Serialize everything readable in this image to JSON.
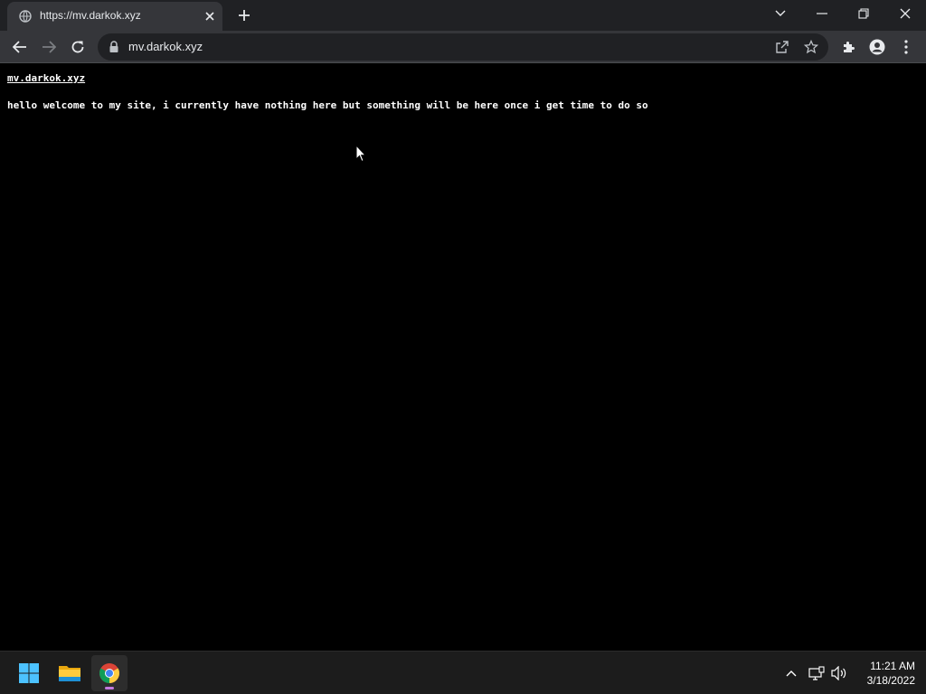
{
  "browser": {
    "tab": {
      "title": "https://mv.darkok.xyz",
      "favicon": "globe-icon"
    },
    "address_bar": {
      "url": "mv.darkok.xyz",
      "security_icon": "lock-icon"
    },
    "toolbar_icons": [
      "back-arrow-icon",
      "forward-arrow-icon",
      "reload-icon",
      "share-icon",
      "star-icon",
      "extensions-puzzle-icon",
      "profile-icon",
      "more-vert-icon"
    ],
    "window_controls": [
      "tab-search-chevron-icon",
      "minimize-icon",
      "restore-icon",
      "close-icon"
    ]
  },
  "page": {
    "link_text": "mv.darkok.xyz",
    "body_text": "hello welcome to my site, i currently have nothing here but something will be here once i get time to do so"
  },
  "taskbar": {
    "apps": [
      "windows-start-icon",
      "file-explorer-icon",
      "chrome-icon"
    ],
    "tray_icons": [
      "chevron-up-icon",
      "network-icon",
      "volume-icon"
    ],
    "time": "11:21 AM",
    "date": "3/18/2022"
  },
  "colors": {
    "page_background": "#000000",
    "tab_strip": "#202124",
    "toolbar": "#35363a",
    "taskbar": "#1c1c1c",
    "text": "#ffffff"
  }
}
